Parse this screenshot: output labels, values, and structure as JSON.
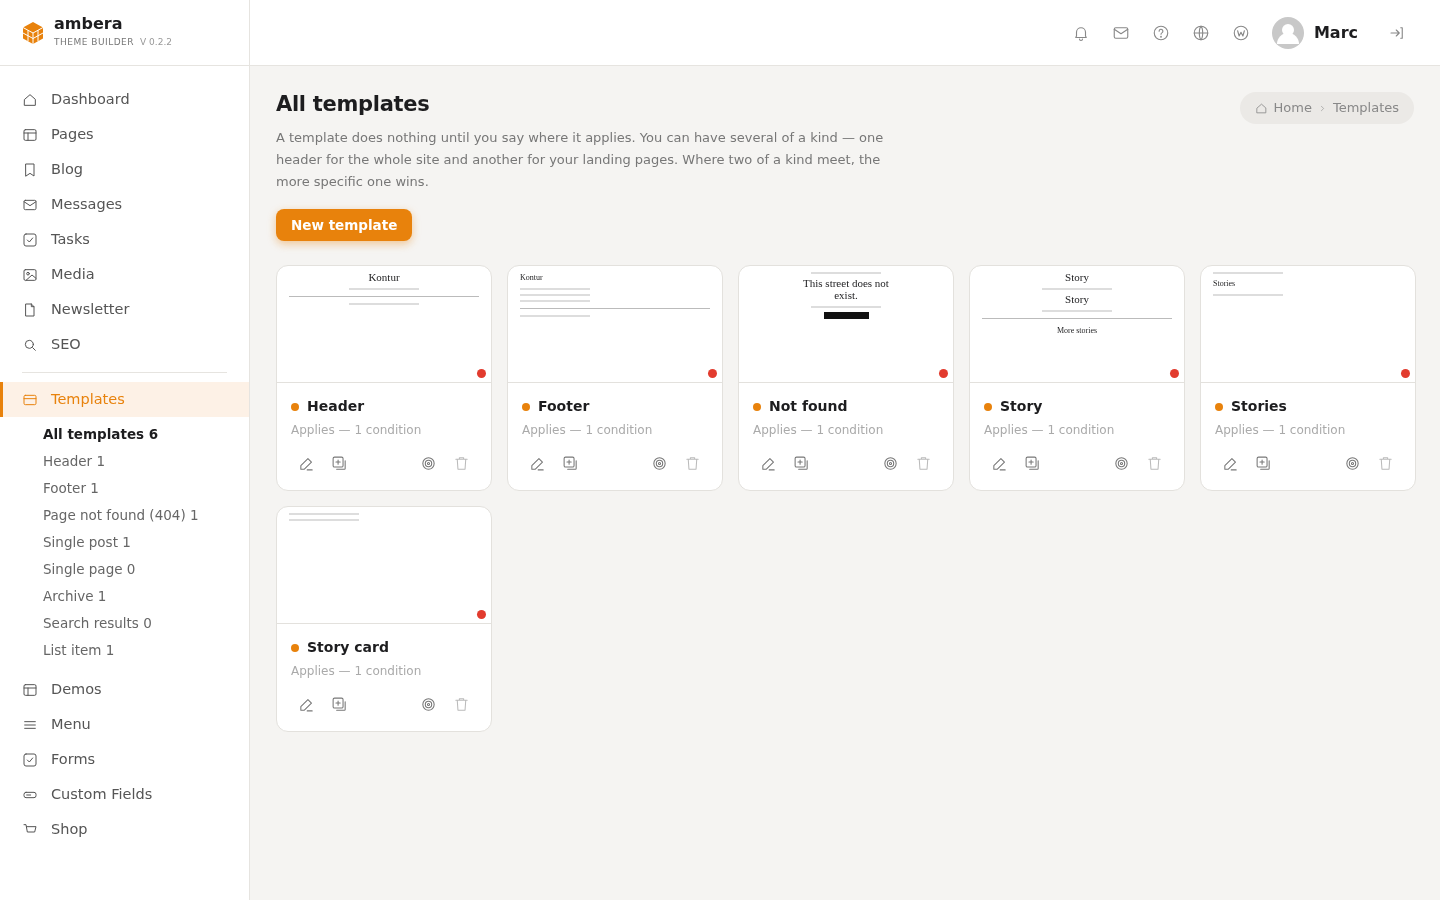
{
  "brand": {
    "name": "ambera",
    "subtitle": "THEME BUILDER",
    "version": "V 0.2.2"
  },
  "user": {
    "name": "Marc"
  },
  "sidebar": {
    "items": [
      {
        "label": "Dashboard",
        "selected": false
      },
      {
        "label": "Pages",
        "selected": false
      },
      {
        "label": "Blog",
        "selected": false
      },
      {
        "label": "Messages",
        "selected": false
      },
      {
        "label": "Tasks",
        "selected": false
      },
      {
        "label": "Media",
        "selected": false
      },
      {
        "label": "Newsletter",
        "selected": false
      },
      {
        "label": "SEO",
        "selected": false
      },
      {
        "label": "Templates",
        "selected": true,
        "children": [
          {
            "label": "All templates 6",
            "selected": true
          },
          {
            "label": "Header 1",
            "selected": false
          },
          {
            "label": "Footer 1",
            "selected": false
          },
          {
            "label": "Page not found (404) 1",
            "selected": false
          },
          {
            "label": "Single post 1",
            "selected": false
          },
          {
            "label": "Single page 0",
            "selected": false
          },
          {
            "label": "Archive 1",
            "selected": false
          },
          {
            "label": "Search results 0",
            "selected": false
          },
          {
            "label": "List item 1",
            "selected": false
          }
        ]
      },
      {
        "label": "Demos",
        "selected": false
      },
      {
        "label": "Menu",
        "selected": false
      },
      {
        "label": "Forms",
        "selected": false
      },
      {
        "label": "Custom Fields",
        "selected": false
      },
      {
        "label": "Shop",
        "selected": false
      }
    ]
  },
  "page": {
    "title": "All templates",
    "description": "A template does nothing until you say where it applies. You can have several of a kind — one header for the whole site and another for your landing pages. Where two of a kind meet, the more specific one wins.",
    "new_button": "New template",
    "breadcrumb": [
      "Home",
      "Templates"
    ]
  },
  "templates": [
    {
      "title": "Header",
      "applies": "Applies — 1 condition",
      "preview": {
        "centered": true,
        "parts": [
          {
            "kind": "title",
            "text": "Kontur"
          },
          {
            "kind": "line"
          },
          {
            "kind": "rule"
          },
          {
            "kind": "line"
          }
        ]
      }
    },
    {
      "title": "Footer",
      "applies": "Applies — 1 condition",
      "preview": {
        "centered": false,
        "parts": [
          {
            "kind": "small",
            "text": "Kontur"
          },
          {
            "kind": "line"
          },
          {
            "kind": "line"
          },
          {
            "kind": "line"
          },
          {
            "kind": "rule"
          },
          {
            "kind": "line"
          }
        ]
      }
    },
    {
      "title": "Not found",
      "applies": "Applies — 1 condition",
      "preview": {
        "centered": true,
        "parts": [
          {
            "kind": "line"
          },
          {
            "kind": "title",
            "text": "This street does not exist."
          },
          {
            "kind": "line"
          },
          {
            "kind": "button"
          }
        ]
      }
    },
    {
      "title": "Story",
      "applies": "Applies — 1 condition",
      "preview": {
        "centered": true,
        "parts": [
          {
            "kind": "title",
            "text": "Story"
          },
          {
            "kind": "line"
          },
          {
            "kind": "title",
            "text": "Story"
          },
          {
            "kind": "line"
          },
          {
            "kind": "rule"
          },
          {
            "kind": "small",
            "text": "More stories"
          }
        ]
      }
    },
    {
      "title": "Stories",
      "applies": "Applies — 1 condition",
      "preview": {
        "centered": false,
        "parts": [
          {
            "kind": "line"
          },
          {
            "kind": "small",
            "text": "Stories"
          },
          {
            "kind": "line"
          }
        ]
      }
    },
    {
      "title": "Story card",
      "applies": "Applies — 1 condition",
      "preview": {
        "centered": false,
        "parts": [
          {
            "kind": "line"
          },
          {
            "kind": "line"
          }
        ]
      }
    }
  ]
}
